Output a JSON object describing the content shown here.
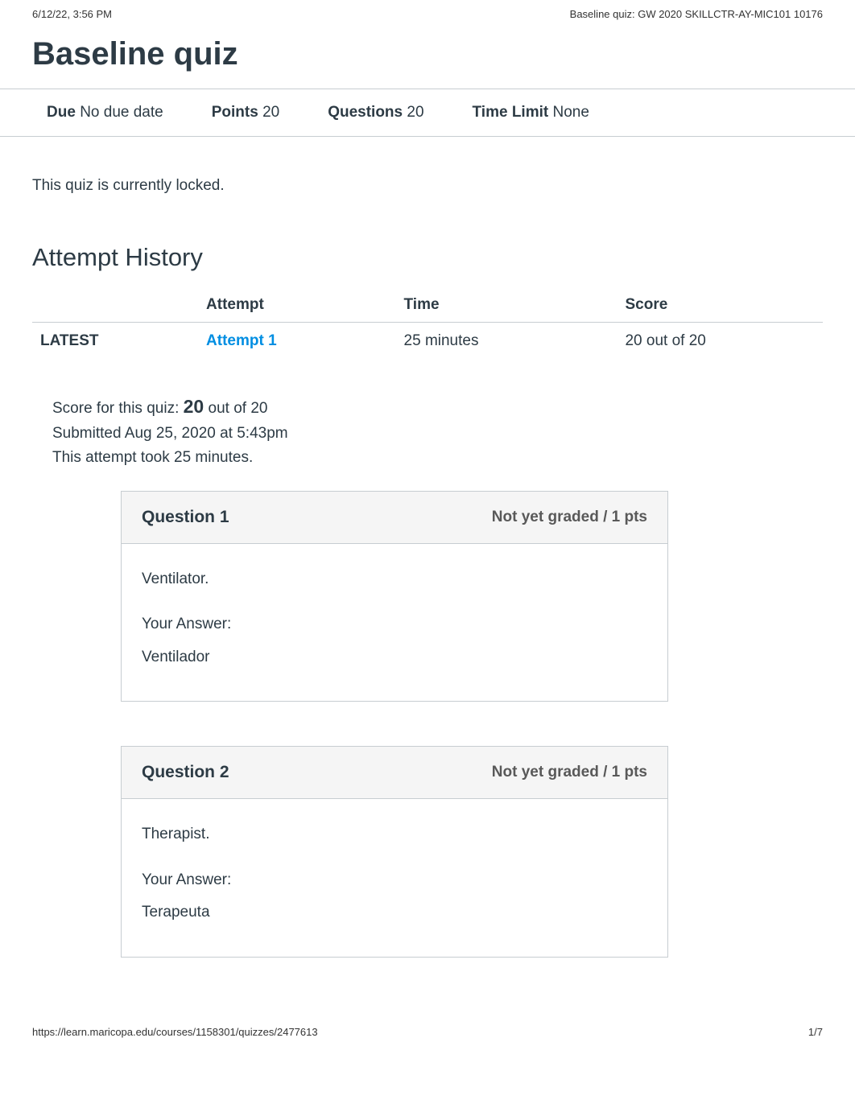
{
  "print_header": {
    "left": "6/12/22, 3:56 PM",
    "right": "Baseline quiz: GW 2020 SKILLCTR-AY-MIC101 10176"
  },
  "page_title": "Baseline quiz",
  "meta": {
    "due_label": "Due",
    "due_value": "No due date",
    "points_label": "Points",
    "points_value": "20",
    "questions_label": "Questions",
    "questions_value": "20",
    "time_limit_label": "Time Limit",
    "time_limit_value": "None"
  },
  "locked_message": "This quiz is currently locked.",
  "attempt_history_title": "Attempt History",
  "attempt_table": {
    "headers": {
      "attempt": "Attempt",
      "time": "Time",
      "score": "Score"
    },
    "rows": [
      {
        "status": "LATEST",
        "attempt": "Attempt 1",
        "time": "25 minutes",
        "score": "20 out of 20"
      }
    ]
  },
  "score_summary": {
    "prefix": "Score for this quiz: ",
    "score": "20",
    "suffix": " out of 20",
    "submitted": "Submitted Aug 25, 2020 at 5:43pm",
    "duration": "This attempt took 25 minutes."
  },
  "questions": [
    {
      "title": "Question 1",
      "points": "Not yet graded / 1 pts",
      "prompt": "Ventilator.",
      "your_answer_label": "Your Answer:",
      "answer": "Ventilador"
    },
    {
      "title": "Question 2",
      "points": "Not yet graded / 1 pts",
      "prompt": "Therapist.",
      "your_answer_label": "Your Answer:",
      "answer": "Terapeuta"
    }
  ],
  "print_footer": {
    "left": "https://learn.maricopa.edu/courses/1158301/quizzes/2477613",
    "right": "1/7"
  }
}
